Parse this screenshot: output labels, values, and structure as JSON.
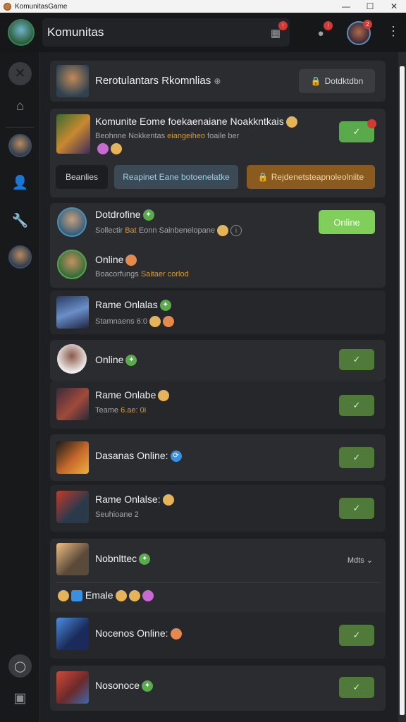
{
  "window": {
    "title": "KomunitasGame",
    "minimize": "—",
    "maximize": "☐",
    "close": "✕"
  },
  "header": {
    "title": "Komunitas",
    "badge_a": "!",
    "badge_b": "!",
    "badge_c": "2",
    "kebab": "⋮"
  },
  "banner": {
    "title": "Rerotulantars Rkomnlias",
    "title_icon": "⊕",
    "button": "Dotdktdbn"
  },
  "featured": {
    "title": "Komunite Eome foekaenaiane Noakkntkais",
    "sub_plain": "Beohnne Nokkentas",
    "sub_highlight": "eiangeiheo",
    "sub_tail": "foaile ber",
    "check": "✓",
    "btn_a": "Beanlies",
    "btn_b": "Reapinet Eane botoenelatke",
    "btn_c": "Rejdenetsteapnoleolniite"
  },
  "online_card": {
    "title": "Dotdrofine",
    "sub_plain": "Sollectir",
    "sub_highlight": "Bat",
    "sub_tail": "Eonn Sainbenelopane",
    "button": "Online"
  },
  "rows": [
    {
      "title": "Online",
      "sub_plain": "Boacorfungs",
      "sub_highlight": "Saitaer corlod",
      "check": ""
    },
    {
      "title": "Rame Onlalas",
      "sub_plain": "Stamnaens",
      "sub_highlight": "6:0",
      "check": ""
    },
    {
      "title": "Online",
      "sub_plain": "",
      "sub_highlight": "",
      "check": "✓"
    },
    {
      "title": "Rame Onlabe",
      "sub_plain": "Teame",
      "sub_highlight": "6.ae: 0i",
      "check": "✓"
    },
    {
      "title": "Dasanas Online:",
      "sub_plain": "",
      "sub_highlight": "",
      "check": "✓"
    },
    {
      "title": "Rame Onlalse:",
      "sub_plain": "Seuhioane 2",
      "sub_highlight": "",
      "check": "✓"
    },
    {
      "title": "Nobnlttec",
      "sub_plain": "",
      "sub_highlight": "",
      "check": "",
      "more": "Mdts ⌄"
    },
    {
      "title": "Emale",
      "sub_plain": "",
      "sub_highlight": "",
      "check": ""
    },
    {
      "title": "Nocenos Online:",
      "sub_plain": "",
      "sub_highlight": "",
      "check": "✓"
    },
    {
      "title": "Nosonoce",
      "sub_plain": "",
      "sub_highlight": "",
      "check": "✓"
    }
  ],
  "sidebar": {
    "close_glyph": "✕",
    "home_glyph": "⌂",
    "user_glyph": "👤",
    "wrench_glyph": "🔧",
    "profile_glyph": "◯",
    "trash_glyph": "▣"
  }
}
